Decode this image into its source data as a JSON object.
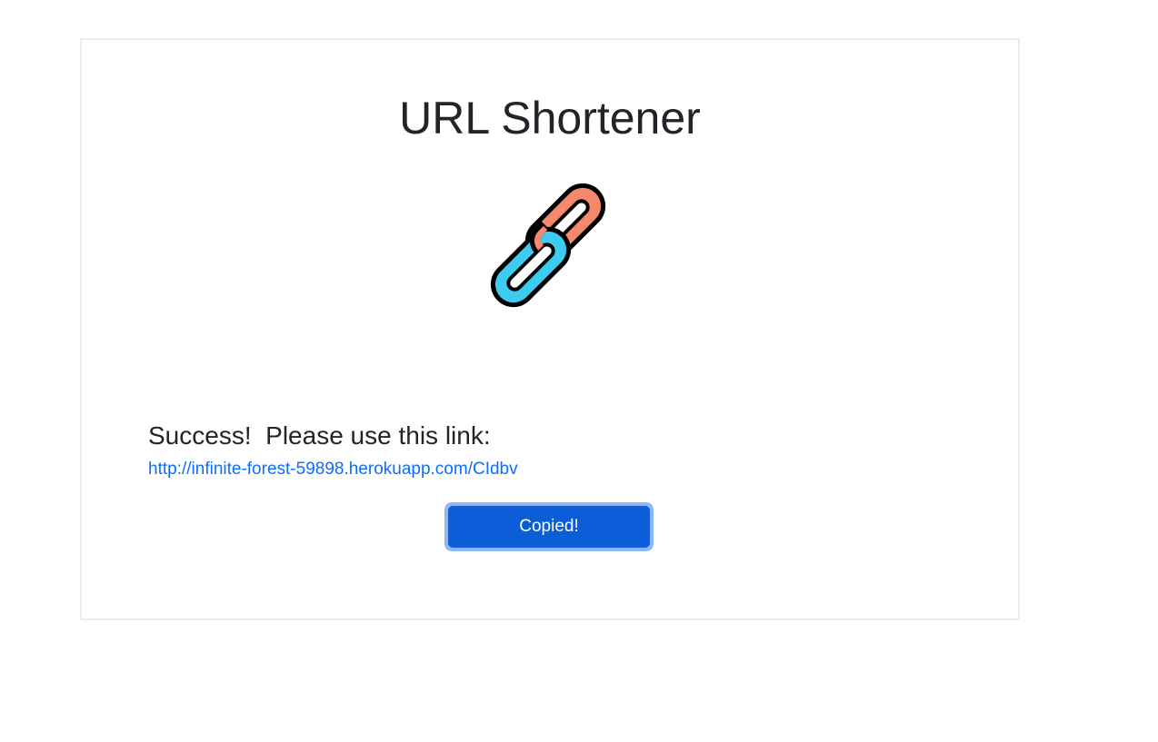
{
  "page": {
    "title": "URL Shortener",
    "logo_icon": "chain-link-icon",
    "logo_colors": {
      "left_link": "#3ecbf0",
      "right_link": "#f4896b",
      "outline": "#000000"
    }
  },
  "result": {
    "heading": "Success!  Please use this link:",
    "short_url": "http://infinite-forest-59898.herokuapp.com/CIdbv"
  },
  "actions": {
    "copy_label": "Copied!"
  },
  "colors": {
    "link": "#0d6efd",
    "button": "#0b5ed7",
    "button_focus_ring": "#8db8f7"
  }
}
